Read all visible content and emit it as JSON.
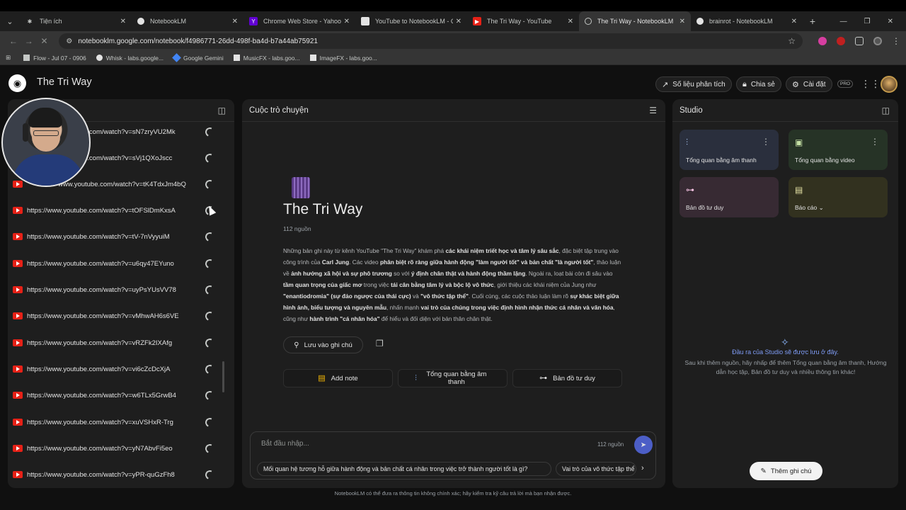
{
  "browser": {
    "tabs": [
      {
        "title": "Tiện ích",
        "color": "#8e918f",
        "icon": "puzzle-icon"
      },
      {
        "title": "NotebookLM",
        "color": "#e3e3e3",
        "icon": "notebooklm-icon"
      },
      {
        "title": "Chrome Web Store - Yahoo Se...",
        "color": "#6001d2",
        "icon": "yahoo-icon"
      },
      {
        "title": "YouTube to NotebookLM - Cửa...",
        "color": "#e62117",
        "icon": "extension-icon"
      },
      {
        "title": "The Tri Way - YouTube",
        "color": "#e62117",
        "icon": "youtube-icon"
      },
      {
        "title": "The Tri Way - NotebookLM",
        "color": "#e3e3e3",
        "icon": "notebooklm-icon"
      },
      {
        "title": "brainrot - NotebookLM",
        "color": "#e3e3e3",
        "icon": "notebooklm-icon"
      }
    ],
    "url": "notebooklm.google.com/notebook/f4986771-26dd-498f-ba4d-b7a44ab75921",
    "bookmarks": [
      "Flow - Jul 07 - 0906",
      "Whisk - labs.google...",
      "Google Gemini",
      "MusicFX - labs.goo...",
      "ImageFX - labs.goo..."
    ]
  },
  "app": {
    "title": "The Tri Way",
    "header_buttons": {
      "analytics": "Số liệu phân tích",
      "share": "Chia sẻ",
      "settings": "Cài đặt"
    },
    "pro_badge": "PRO"
  },
  "sources": {
    "items": [
      "https://www.youtube.com/watch?v=sN7zryVU2Mk",
      "https://www.youtube.com/watch?v=sVj1QXoJscc",
      "https://www.youtube.com/watch?v=tK4TdxJm4bQ",
      "https://www.youtube.com/watch?v=tOFSlDmKxsA",
      "https://www.youtube.com/watch?v=tV-7nVyyuiM",
      "https://www.youtube.com/watch?v=u6qy47EYuno",
      "https://www.youtube.com/watch?v=uyPsYUsVV78",
      "https://www.youtube.com/watch?v=vMhwAH6s6VE",
      "https://www.youtube.com/watch?v=vRZFk2IXAfg",
      "https://www.youtube.com/watch?v=vi6cZcDcXjA",
      "https://www.youtube.com/watch?v=w6TLx5GrwB4",
      "https://www.youtube.com/watch?v=xuVSHxR-Trg",
      "https://www.youtube.com/watch?v=yN7AbvFi5eo",
      "https://www.youtube.com/watch?v=yPR-quGzFh8"
    ],
    "visible_text": [
      "e.com/watch?v=sN7zryVU2Mk",
      "e.com/watch?v=sVj1QXoJscc",
      "www.youtube.com/watch?v=tK4TdxJm4bQ"
    ]
  },
  "chat": {
    "header": "Cuộc trò chuyện",
    "notebook_title": "The Tri Way",
    "source_count": "112 nguồn",
    "summary_parts": [
      {
        "t": "Những bản ghi này từ kênh YouTube \"The Tri Way\" khám phá ",
        "b": false
      },
      {
        "t": "các khái niệm triết học và tâm lý sâu sắc",
        "b": true
      },
      {
        "t": ", đặc biệt tập trung vào công trình của ",
        "b": false
      },
      {
        "t": "Carl Jung",
        "b": true
      },
      {
        "t": ". Các video ",
        "b": false
      },
      {
        "t": "phân biệt rõ ràng giữa hành động \"làm người tốt\" và bản chất \"là người tốt\"",
        "b": true
      },
      {
        "t": ", thảo luận về ",
        "b": false
      },
      {
        "t": "ảnh hưởng xã hội và sự phô trương",
        "b": true
      },
      {
        "t": " so với ",
        "b": false
      },
      {
        "t": "ý định chân thật và hành động thầm lặng",
        "b": true
      },
      {
        "t": ". Ngoài ra, loạt bài còn đi sâu vào ",
        "b": false
      },
      {
        "t": "tầm quan trọng của giấc mơ",
        "b": true
      },
      {
        "t": " trong việc ",
        "b": false
      },
      {
        "t": "tái cân bằng tâm lý và bộc lộ vô thức",
        "b": true
      },
      {
        "t": ", giới thiệu các khái niệm của Jung như ",
        "b": false
      },
      {
        "t": "\"enantiodromia\" (sự đảo ngược của thái cực)",
        "b": true
      },
      {
        "t": " và ",
        "b": false
      },
      {
        "t": "\"vô thức tập thể\"",
        "b": true
      },
      {
        "t": ". Cuối cùng, các cuộc thảo luận làm rõ ",
        "b": false
      },
      {
        "t": "sự khác biệt giữa hình ảnh, biểu tượng và nguyên mẫu",
        "b": true
      },
      {
        "t": ", nhấn mạnh ",
        "b": false
      },
      {
        "t": "vai trò của chúng trong việc định hình nhận thức cá nhân và văn hóa",
        "b": true
      },
      {
        "t": ", cũng như ",
        "b": false
      },
      {
        "t": "hành trình \"cá nhân hóa\"",
        "b": true
      },
      {
        "t": " để hiểu và đối diện với bản thân chân thật.",
        "b": false
      }
    ],
    "save_note": "Lưu vào ghi chú",
    "actions": {
      "add_note": "Add note",
      "audio_overview": "Tổng quan bằng âm thanh",
      "mind_map": "Bản đồ tư duy"
    },
    "input_placeholder": "Bắt đầu nhập...",
    "input_source_count": "112 nguồn",
    "suggestions": [
      "Mối quan hệ tương hỗ giữa hành động và bản chất cá nhân trong việc trở thành người tốt là gì?",
      "Vai trò của vô thức tập thể"
    ],
    "disclaimer": "NotebookLM có thể đưa ra thông tin không chính xác; hãy kiểm tra kỹ câu trả lời mà bạn nhận được."
  },
  "studio": {
    "header": "Studio",
    "cards": {
      "audio": "Tổng quan bằng âm thanh",
      "video": "Tổng quan bằng video",
      "mindmap": "Bản đồ tư duy",
      "report": "Báo cáo"
    },
    "empty_title": "Đầu ra của Studio sẽ được lưu ở đây.",
    "empty_desc": "Sau khi thêm nguồn, hãy nhấp để thêm Tổng quan bằng âm thanh, Hướng dẫn học tập, Bản đồ tư duy và nhiều thông tin khác!",
    "add_note": "Thêm ghi chú"
  },
  "colors": {
    "accent": "#4c5ec6",
    "studio_accent": "#7f9cf5",
    "youtube_red": "#e62117"
  }
}
